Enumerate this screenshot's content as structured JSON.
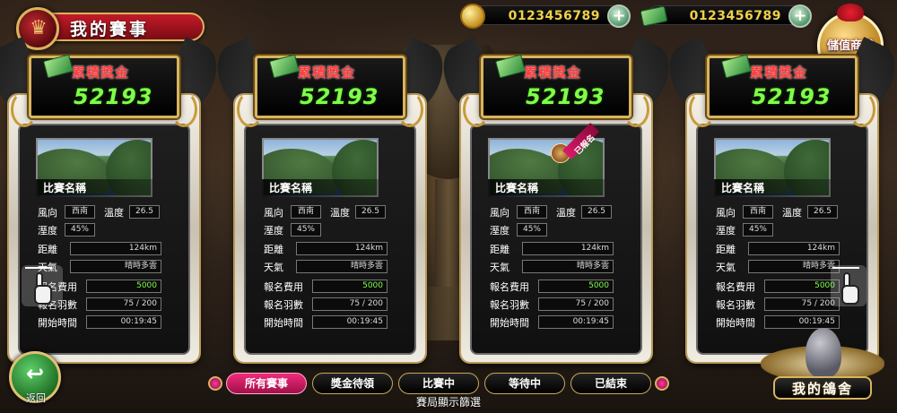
{
  "header": {
    "title": "我的賽事",
    "coin_balance": "0123456789",
    "cash_balance": "0123456789",
    "store_label": "儲值商城"
  },
  "cards": [
    {
      "prize_label": "累積獎金",
      "prize_value": "52193",
      "race_name": "比賽名稱",
      "labels": {
        "wind": "風向",
        "temp": "溫度",
        "humidity": "溼度",
        "distance": "距離",
        "weather": "天氣",
        "fee": "報名費用",
        "count": "報名羽數",
        "start": "開始時間"
      },
      "wind": "西南",
      "temp": "26.5",
      "humidity": "45%",
      "distance": "124km",
      "weather": "晴時多雲",
      "fee": "5000",
      "count": "75 / 200",
      "start": "00:19:45",
      "signed": false
    },
    {
      "prize_label": "累積獎金",
      "prize_value": "52193",
      "race_name": "比賽名稱",
      "labels": {
        "wind": "風向",
        "temp": "溫度",
        "humidity": "溼度",
        "distance": "距離",
        "weather": "天氣",
        "fee": "報名費用",
        "count": "報名羽數",
        "start": "開始時間"
      },
      "wind": "西南",
      "temp": "26.5",
      "humidity": "45%",
      "distance": "124km",
      "weather": "晴時多雲",
      "fee": "5000",
      "count": "75 / 200",
      "start": "00:19:45",
      "signed": false
    },
    {
      "prize_label": "累積獎金",
      "prize_value": "52193",
      "race_name": "比賽名稱",
      "labels": {
        "wind": "風向",
        "temp": "溫度",
        "humidity": "溼度",
        "distance": "距離",
        "weather": "天氣",
        "fee": "報名費用",
        "count": "報名羽數",
        "start": "開始時間"
      },
      "wind": "西南",
      "temp": "26.5",
      "humidity": "45%",
      "distance": "124km",
      "weather": "晴時多雲",
      "fee": "5000",
      "count": "75 / 200",
      "start": "00:19:45",
      "signed": true,
      "signed_label": "已報名"
    },
    {
      "prize_label": "累積獎金",
      "prize_value": "52193",
      "race_name": "比賽名稱",
      "labels": {
        "wind": "風向",
        "temp": "溫度",
        "humidity": "溼度",
        "distance": "距離",
        "weather": "天氣",
        "fee": "報名費用",
        "count": "報名羽數",
        "start": "開始時間"
      },
      "wind": "西南",
      "temp": "26.5",
      "humidity": "45%",
      "distance": "124km",
      "weather": "晴時多雲",
      "fee": "5000",
      "count": "75 / 200",
      "start": "00:19:45",
      "signed": false
    }
  ],
  "filters": {
    "items": [
      "所有賽事",
      "獎金待領",
      "比賽中",
      "等待中",
      "已結束"
    ],
    "active_index": 0,
    "caption": "賽局顯示篩選"
  },
  "footer": {
    "back_label": "返回",
    "pigeon_label": "我的鴿舍"
  },
  "icons": {
    "emblem": "crest-icon",
    "coin": "gold-coin-icon",
    "cash": "cash-icon",
    "plus": "plus-icon",
    "store": "gift-bag-icon",
    "back": "back-arrow-icon",
    "swipe": "swipe-hand-icon"
  },
  "colors": {
    "accent_red": "#c41a28",
    "gold": "#d7b460",
    "prize_green": "#7fff4a",
    "filter_active": "#f02a7a"
  }
}
